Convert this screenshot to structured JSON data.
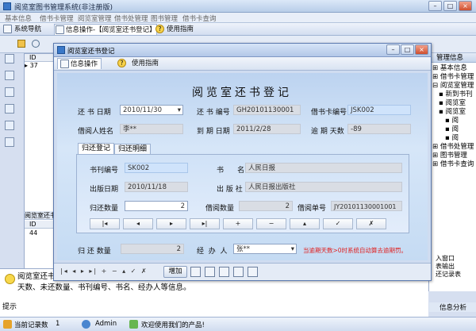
{
  "window": {
    "title": "阅览室图书管理系统(非注册版)"
  },
  "menu": [
    "基本信息",
    "借书卡管理",
    "阅览室管理",
    "借书处管理",
    "图书管理",
    "借书卡查询"
  ],
  "tabs": {
    "nav": "系统导航",
    "active": "信息操作-【阅览室还书登记】",
    "help": "使用指南"
  },
  "left_grid": {
    "col_id": "ID",
    "row_marker": "▸",
    "row_value": "37",
    "bottom_title": "阅览室还书刊",
    "bottom_col": "ID",
    "bottom_value": "44"
  },
  "right_panel": {
    "title": "管理信息",
    "tree": [
      "基本信息",
      "借书卡管理",
      "阅览室管理",
      "新到书刊",
      "阅览室",
      "阅览室",
      "阅",
      "阅",
      "阅",
      "借书处管理",
      "图书管理",
      "借书卡查询"
    ],
    "extra": [
      "入窗口",
      "表输出",
      "还记录表"
    ],
    "bottom": "信息分析"
  },
  "dialog": {
    "title": "阅览室还书登记",
    "tab_ops": "信息操作",
    "tab_help": "使用指南",
    "heading": "阅览室还书登记",
    "fields": {
      "return_date_label": "还 书 日期",
      "return_date": "2010/11/30",
      "return_no_label": "还 书 编号",
      "return_no": "GH20101130001",
      "card_no_label": "借书卡编号",
      "card_no": "JSK002",
      "borrower_label": "借阅人姓名",
      "borrower": "李**",
      "due_date_label": "到 期 日期",
      "due_date": "2011/2/28",
      "overdue_label": "逾 期 天数",
      "overdue": "-89"
    },
    "subtabs": [
      "归还登记",
      "归还明细"
    ],
    "detail": {
      "book_no_label": "书刊编号",
      "book_no": "SK002",
      "book_name_label": "书      名",
      "book_name": "人民日报",
      "pub_date_label": "出版日期",
      "pub_date": "2010/11/18",
      "publisher_label": "出 版 社",
      "publisher": "人民日报出版社",
      "return_qty_label": "归还数量",
      "return_qty": "2",
      "borrow_qty_label": "借阅数量",
      "borrow_qty": "2",
      "borrow_no_label": "借阅单号",
      "borrow_no": "JY20101130001001"
    },
    "nav_buttons": [
      "|◂",
      "◂",
      "▸",
      "▸|",
      "+",
      "−",
      "▴",
      "✓",
      "✗"
    ],
    "total_label": "归 还 数量",
    "total": "2",
    "handler_label": "经  办  人",
    "handler": "张**",
    "note": "当逾期天数>0时系统自动算去逾期罚。",
    "footer_button": "增加"
  },
  "description": {
    "text": "阅览室还书登记：记录所有阅览室还书的情况，它包括归还日期、归还编号、借书卡编号、借阅人姓名、归还数量、逾期天数、未还数量、书刊编号、书名、经办人等信息。",
    "label": "提示"
  },
  "status": {
    "record_label": "当前记录数",
    "record_count": "1",
    "user": "Admin",
    "welcome": "欢迎使用我们的产品!"
  }
}
